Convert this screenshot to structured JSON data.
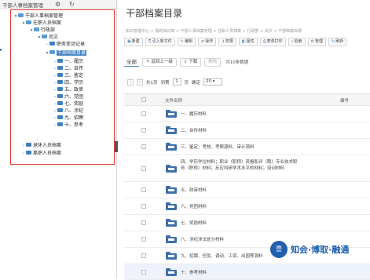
{
  "topbar": {
    "title": "干部人事档案管理",
    "icons": [
      "gear-icon",
      "refresh-icon"
    ]
  },
  "tree": {
    "nodes": [
      {
        "label": "干部人事档案管理",
        "level": 0,
        "expanded": true
      },
      {
        "label": "在职人员档案",
        "level": 1,
        "expanded": true
      },
      {
        "label": "行政部",
        "level": 2,
        "expanded": true
      },
      {
        "label": "尚文",
        "level": 3,
        "expanded": true
      },
      {
        "label": "职务变动记录",
        "level": 4,
        "expanded": false
      },
      {
        "label": "干部档案目录",
        "level": 4,
        "expanded": true,
        "selected": true
      },
      {
        "label": "一、履历",
        "level": 5
      },
      {
        "label": "二、自传",
        "level": 5
      },
      {
        "label": "三、鉴定",
        "level": 5
      },
      {
        "label": "四、学历",
        "level": 5
      },
      {
        "label": "五、政审",
        "level": 5
      },
      {
        "label": "六、党团",
        "level": 5
      },
      {
        "label": "七、奖励",
        "level": 5
      },
      {
        "label": "八、涉纪",
        "level": 5
      },
      {
        "label": "九、招聘",
        "level": 5
      },
      {
        "label": "十、参考",
        "level": 5
      },
      {
        "label": "退休人员档案",
        "level": 1,
        "expanded": false
      },
      {
        "label": "离职人员档案",
        "level": 1,
        "expanded": false
      }
    ]
  },
  "main": {
    "title": "干部档案目录",
    "breadcrumb": "知识管理中心 > 我的知识库 > 干部人事档案管理 > 在职人员档案 > 行政部 > 尚文 > 干部档案目录",
    "toolbar": [
      "新建",
      "引入新文件",
      "编辑",
      "操作",
      "权限",
      "属性",
      "表单打印",
      "检索",
      "管理",
      "刷新"
    ],
    "tabs": {
      "all": "全部",
      "up": "返回上一级",
      "download": "下载",
      "delete": "删除",
      "count": "共10条数据"
    },
    "pager": {
      "prev": "‹",
      "next": "›",
      "total_pages": "共1页",
      "goto_label": "到第",
      "page": "1",
      "page_unit": "页",
      "confirm": "确定",
      "page_size": "20"
    },
    "columns": {
      "name": "文件名称",
      "no": "编号"
    },
    "rows": [
      "一、履历材料",
      "二、自传材料",
      "三、鉴定、考核、考察源料、审计源料",
      "四、学历学位材料；职业（职称）资格和评（聘）专业技术职务（职称）材料；反应科研学术水平的材料；培训材料",
      "五、政审材料",
      "六、党团材料",
      "七、奖励材料",
      "八、涉纪涉法处分材料",
      "九、招聘、任免、调动、工资、出国等源料",
      "十、参考材料"
    ]
  },
  "watermark": {
    "logo_text": "壹",
    "text": "知会·博取·融通"
  }
}
